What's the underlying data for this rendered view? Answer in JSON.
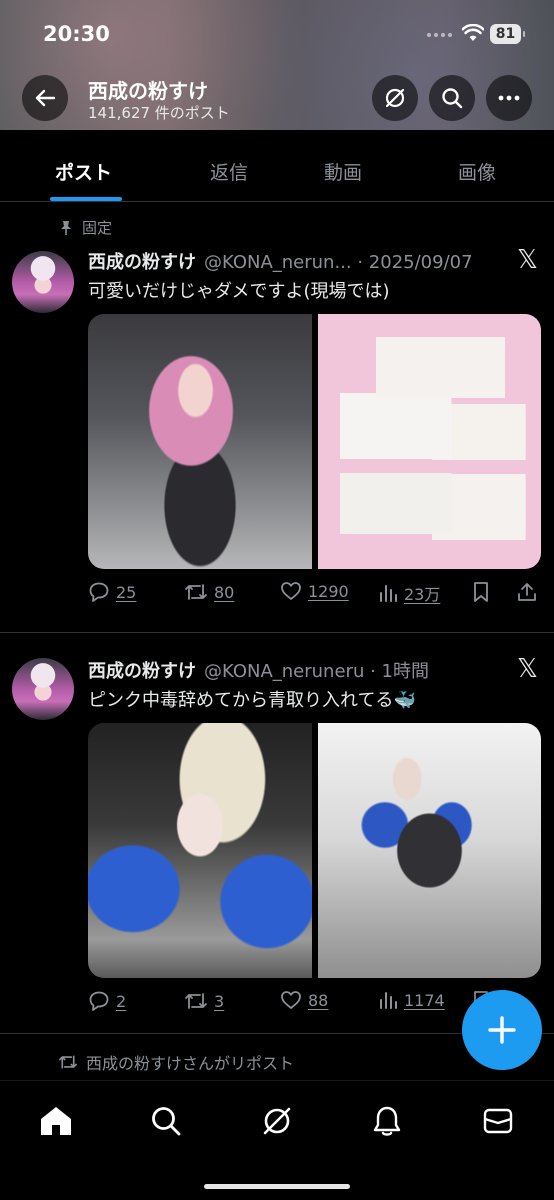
{
  "status_bar": {
    "time": "20:30",
    "battery": "81"
  },
  "profile": {
    "name": "西成の粉すけ",
    "post_count": "141,627 件のポスト"
  },
  "tabs": [
    {
      "label": "ポスト",
      "active": true
    },
    {
      "label": "返信",
      "active": false
    },
    {
      "label": "動画",
      "active": false
    },
    {
      "label": "画像",
      "active": false
    }
  ],
  "tweets": [
    {
      "pinned_label": "固定",
      "author": "西成の粉すけ",
      "handle_time": "@KONA_nerun... · 2025/09/07",
      "text": "可愛いだけじゃダメですよ(現場では)",
      "replies": "25",
      "reposts": "80",
      "likes": "1290",
      "views": "23万"
    },
    {
      "author": "西成の粉すけ",
      "handle_time": "@KONA_neruneru · 1時間",
      "text": "ピンク中毒辞めてから青取り入れてる🐳",
      "replies": "2",
      "reposts": "3",
      "likes": "88",
      "views": "1174"
    }
  ],
  "retweet_context": "西成の粉すけさんがリポスト",
  "icons": {
    "accent": "#1d9bf0",
    "x_logo": "𝕏"
  }
}
